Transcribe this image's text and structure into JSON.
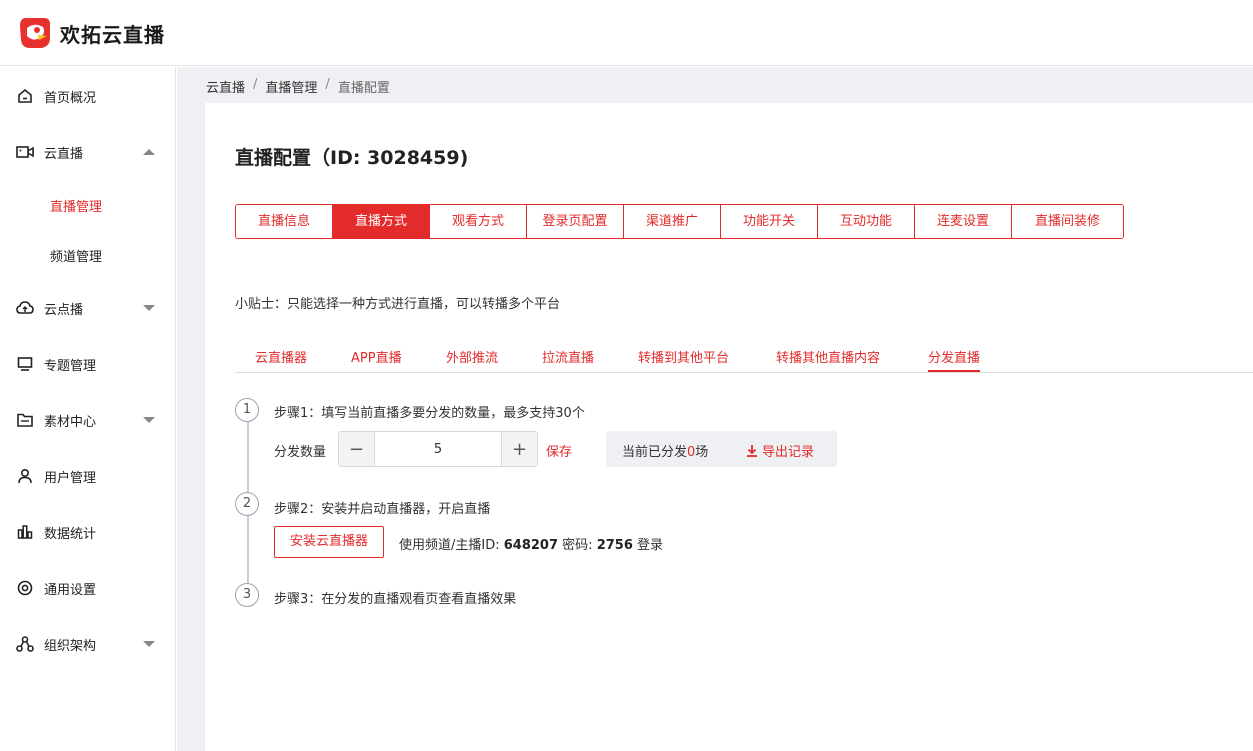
{
  "app": {
    "name": "欢拓云直播"
  },
  "sidebar": {
    "items": [
      {
        "label": "首页概况"
      },
      {
        "label": "云直播"
      },
      {
        "label": "云点播"
      },
      {
        "label": "专题管理"
      },
      {
        "label": "素材中心"
      },
      {
        "label": "用户管理"
      },
      {
        "label": "数据统计"
      },
      {
        "label": "通用设置"
      },
      {
        "label": "组织架构"
      }
    ],
    "sub_items": [
      {
        "label": "直播管理"
      },
      {
        "label": "频道管理"
      }
    ]
  },
  "breadcrumb": {
    "items": [
      "云直播",
      "直播管理",
      "直播配置"
    ],
    "sep": "/"
  },
  "page": {
    "title": "直播配置（ID: 3028459)"
  },
  "tabs": [
    "直播信息",
    "直播方式",
    "观看方式",
    "登录页配置",
    "渠道推广",
    "功能开关",
    "互动功能",
    "连麦设置",
    "直播间装修"
  ],
  "tip": "小贴士：只能选择一种方式进行直播，可以转播多个平台",
  "subtabs": [
    "云直播器",
    "APP直播",
    "外部推流",
    "拉流直播",
    "转播到其他平台",
    "转播其他直播内容",
    "分发直播"
  ],
  "steps": [
    {
      "num": "1",
      "title": "步骤1：填写当前直播多要分发的数量，最多支持30个"
    },
    {
      "num": "2",
      "title": "步骤2：安装并启动直播器，开启直播"
    },
    {
      "num": "3",
      "title": "步骤3：在分发的直播观看页查看直播效果"
    }
  ],
  "distribution": {
    "qty_label": "分发数量",
    "qty_value": "5",
    "minus": "−",
    "plus": "+",
    "save_label": "保存",
    "current_prefix": "当前已分发",
    "current_count": "0",
    "current_suffix": "场",
    "export_label": "导出记录"
  },
  "install": {
    "button_label": "安装云直播器",
    "info_prefix": "使用频道/主播ID: ",
    "channel_id": "648207",
    "pwd_prefix": " 密码: ",
    "password": "2756",
    "login_suffix": " 登录"
  },
  "colors": {
    "accent": "#e32b2b",
    "gutter": "#eef0f3"
  }
}
